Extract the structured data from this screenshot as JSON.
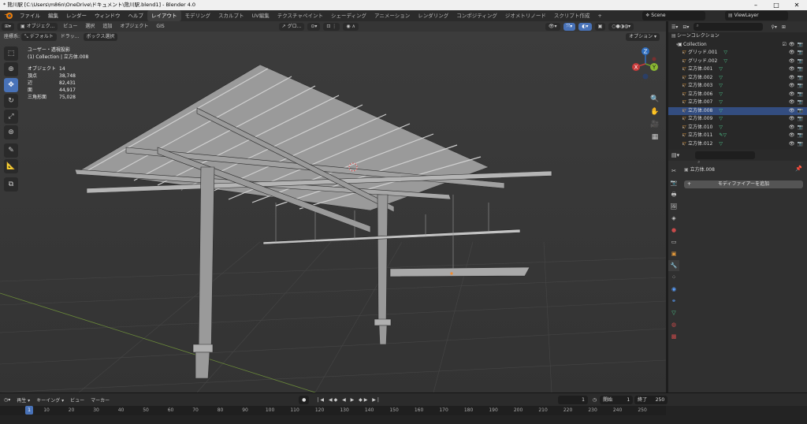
{
  "window": {
    "title": "* 熊川駅 [C:\\Users\\m86n\\OneDrive\\ドキュメント\\熊川駅.blend1] - Blender 4.0"
  },
  "menu": [
    "ファイル",
    "編集",
    "レンダー",
    "ウィンドウ",
    "ヘルプ"
  ],
  "workspaces": [
    "レイアウト",
    "モデリング",
    "スカルプト",
    "UV編集",
    "テクスチャペイント",
    "シェーディング",
    "アニメーション",
    "レンダリング",
    "コンポジティング",
    "ジオメトリノード",
    "スクリプト作成"
  ],
  "workspace_add": "+",
  "scene": "Scene",
  "view_layer": "ViewLayer",
  "viewport": {
    "mode": "オブジェク...",
    "header_menus": [
      "ビュー",
      "選択",
      "追加",
      "オブジェクト",
      "GIS"
    ],
    "transform_orientation": "グロ...",
    "coord_label": "座標系:",
    "coord_value": "デフォルト",
    "drag_label": "ドラッ...",
    "box_select": "ボックス選択",
    "options": "オプション",
    "view_name": "ユーザー・透視投影",
    "collection_info": "(1) Collection | 立方体.008",
    "stats": [
      {
        "label": "オブジェクト",
        "value": "14"
      },
      {
        "label": "頂点",
        "value": "38,748"
      },
      {
        "label": "辺",
        "value": "82,431"
      },
      {
        "label": "面",
        "value": "44,917"
      },
      {
        "label": "三角形面",
        "value": "75,028"
      }
    ],
    "gizmo": {
      "x": "X",
      "y": "Y",
      "z": "Z"
    }
  },
  "outliner": {
    "root": "シーンコレクション",
    "collection": "Collection",
    "items": [
      {
        "name": "グリッド.001",
        "selected": false
      },
      {
        "name": "グリッド.002",
        "selected": false
      },
      {
        "name": "立方体.001",
        "selected": false
      },
      {
        "name": "立方体.002",
        "selected": false
      },
      {
        "name": "立方体.003",
        "selected": false
      },
      {
        "name": "立方体.006",
        "selected": false
      },
      {
        "name": "立方体.007",
        "selected": false
      },
      {
        "name": "立方体.008",
        "selected": true
      },
      {
        "name": "立方体.009",
        "selected": false
      },
      {
        "name": "立方体.010",
        "selected": false
      },
      {
        "name": "立方体.011",
        "selected": false
      },
      {
        "name": "立方体.012",
        "selected": false
      }
    ]
  },
  "properties": {
    "object_name": "立方体.008",
    "add_modifier": "モディファイアーを追加"
  },
  "timeline": {
    "playback": "再生",
    "keying": "キーイング",
    "view": "ビュー",
    "marker": "マーカー",
    "current_frame": "1",
    "start_label": "開始",
    "start": "1",
    "end_label": "終了",
    "end": "250",
    "ruler": [
      "1",
      "10",
      "20",
      "30",
      "40",
      "50",
      "60",
      "70",
      "80",
      "90",
      "100",
      "110",
      "120",
      "130",
      "140",
      "150",
      "160",
      "170",
      "180",
      "190",
      "200",
      "210",
      "220",
      "230",
      "240",
      "250"
    ]
  },
  "colors": {
    "accent": "#4872b8",
    "selected_row": "#334d80",
    "modifier": "#4cc78c",
    "object": "#e39a3a"
  }
}
